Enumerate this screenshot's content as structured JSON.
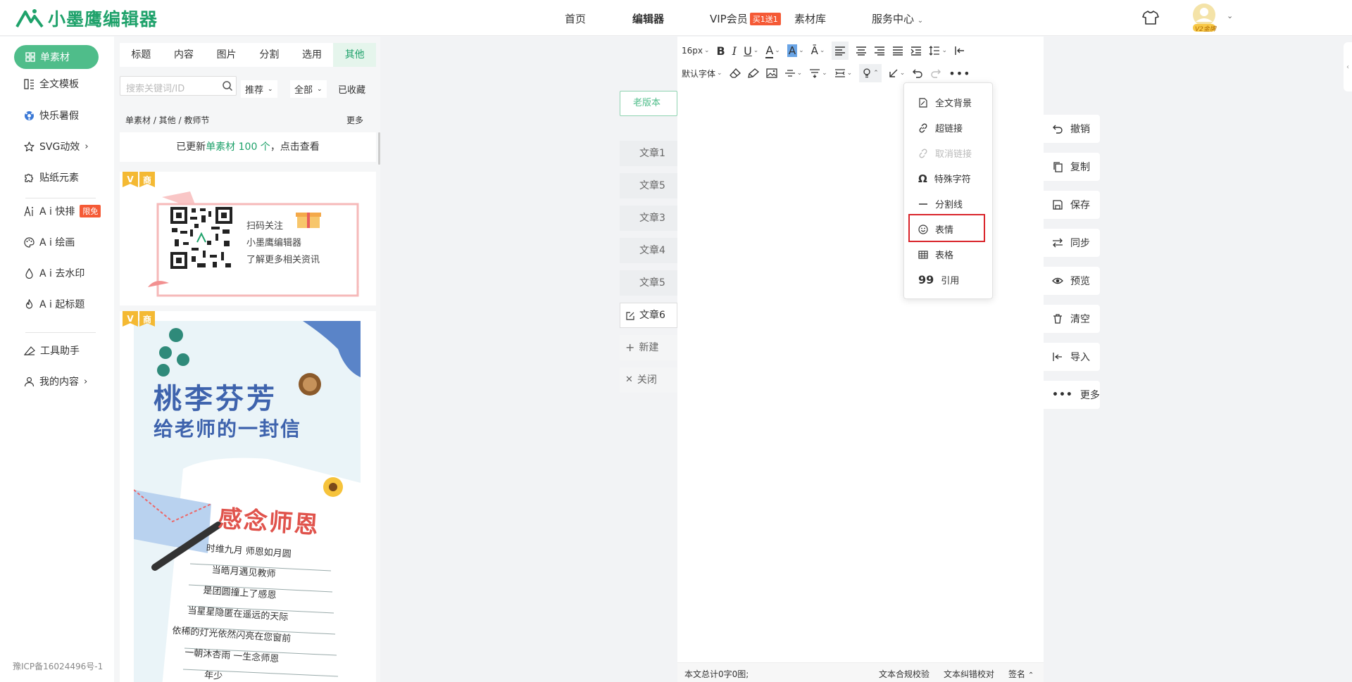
{
  "header": {
    "logo_text": "小墨鹰编辑器",
    "nav": [
      "首页",
      "编辑器",
      "VIP会员",
      "素材库",
      "服务中心"
    ],
    "vip_tag": "买1送1",
    "avatar_badge": "V2金牌"
  },
  "leftnav": {
    "items": [
      "单素材",
      "全文模板",
      "快乐暑假",
      "SVG动效",
      "贴纸元素",
      "A i 快排",
      "A i 绘画",
      "A i 去水印",
      "A i 起标题",
      "工具助手",
      "我的内容"
    ],
    "limited_badge": "限免",
    "icp": "豫ICP备16024496号-1"
  },
  "panel": {
    "tabs": [
      "标题",
      "内容",
      "图片",
      "分割",
      "选用",
      "其他"
    ],
    "active_tab": "其他",
    "search_placeholder": "搜索关键词/ID",
    "filter_sort": "推荐",
    "filter_all": "全部",
    "favorites": "已收藏",
    "breadcrumb": "单素材 / 其他 / 教师节",
    "more": "更多",
    "updated_prefix": "已更新",
    "updated_highlight": "单素材 100 个",
    "updated_suffix": "，点击查看",
    "badge_v": "V",
    "badge_shang": "商",
    "card1": {
      "line1": "扫码关注",
      "line2": "小墨鹰编辑器",
      "line3": "了解更多相关资讯"
    },
    "card2": {
      "title1": "桃李芬芳",
      "title2": "给老师的一封信",
      "heading": "感念师恩",
      "poem": [
        "时维九月 师恩如月圆",
        "当皓月遇见教师",
        "是团圆撞上了感恩",
        "当星星隐匿在遥远的天际",
        "依稀的灯光依然闪亮在您窗前",
        "一朝沐杏雨 一生念师恩",
        "年少"
      ]
    }
  },
  "editor": {
    "old_version": "老版本",
    "article_tabs": [
      "文章1",
      "文章5",
      "文章3",
      "文章4",
      "文章5",
      "文章6"
    ],
    "new_label": "新建",
    "close_label": "关闭",
    "font_size": "16px",
    "font_family": "默认字体",
    "dropdown": [
      "全文背景",
      "超链接",
      "取消链接",
      "特殊字符",
      "分割线",
      "表情",
      "表格",
      "引用"
    ],
    "status_left": "本文总计0字0图;",
    "status_check": "文本合规校验",
    "status_proof": "文本纠错校对",
    "status_sign": "签名"
  },
  "right_actions": [
    "撤销",
    "复制",
    "保存",
    "同步",
    "预览",
    "清空",
    "导入",
    "更多"
  ],
  "colors": {
    "brand": "#1fa26b",
    "active_pill": "#4fbd8a",
    "highlight_border": "#d9242a"
  }
}
